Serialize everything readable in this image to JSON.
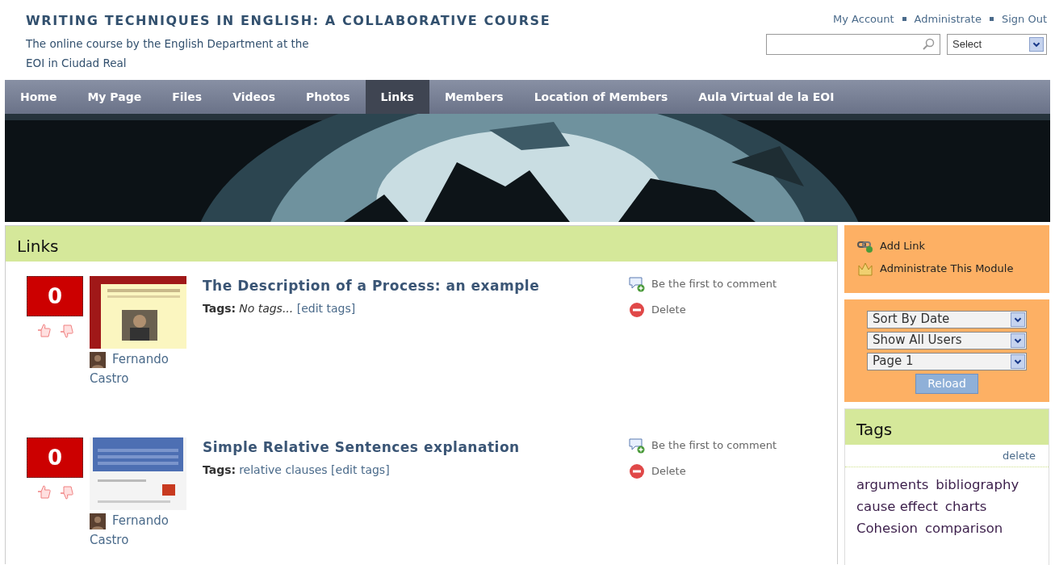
{
  "site": {
    "title": "WRITING TECHNIQUES IN ENGLISH: A COLLABORATIVE COURSE",
    "subtitle_lines": [
      "The online course by the English Department at the",
      "EOI in Ciudad Real"
    ]
  },
  "user_links": [
    "My Account",
    "Administrate",
    "Sign Out"
  ],
  "search": {
    "select": "Select"
  },
  "nav": [
    {
      "label": "Home",
      "selected": false
    },
    {
      "label": "My Page",
      "selected": false
    },
    {
      "label": "Files",
      "selected": false
    },
    {
      "label": "Videos",
      "selected": false
    },
    {
      "label": "Photos",
      "selected": false
    },
    {
      "label": "Links",
      "selected": true
    },
    {
      "label": "Members",
      "selected": false
    },
    {
      "label": "Location of Members",
      "selected": false
    },
    {
      "label": "Aula Virtual de la EOI",
      "selected": false
    }
  ],
  "links_panel": {
    "title": "Links",
    "items": [
      {
        "score": "0",
        "title": "The Description of a Process: an example",
        "tags_label": "Tags:",
        "tags": "No tags...",
        "tags_empty": true,
        "edit_tags": "[edit tags]",
        "author_lines": [
          "Fernando",
          "Castro"
        ],
        "comment": "Be the first to comment",
        "delete": "Delete"
      },
      {
        "score": "0",
        "title": "Simple Relative Sentences explanation",
        "tags_label": "Tags:",
        "tags": "relative clauses",
        "tags_empty": false,
        "edit_tags": "[edit tags]",
        "author_lines": [
          "Fernando",
          "Castro"
        ],
        "comment": "Be the first to comment",
        "delete": "Delete"
      }
    ]
  },
  "actions": [
    {
      "kind": "add",
      "label": "Add Link"
    },
    {
      "kind": "admin",
      "label": "Administrate This Module"
    }
  ],
  "filters": {
    "selects": [
      "Sort By Date",
      "Show All Users",
      "Page 1"
    ],
    "button": "Reload"
  },
  "tags_panel": {
    "title": "Tags",
    "delete": "delete",
    "tags": [
      "arguments",
      "bibliography",
      "cause effect",
      "charts",
      "Cohesion",
      "comparison"
    ]
  }
}
